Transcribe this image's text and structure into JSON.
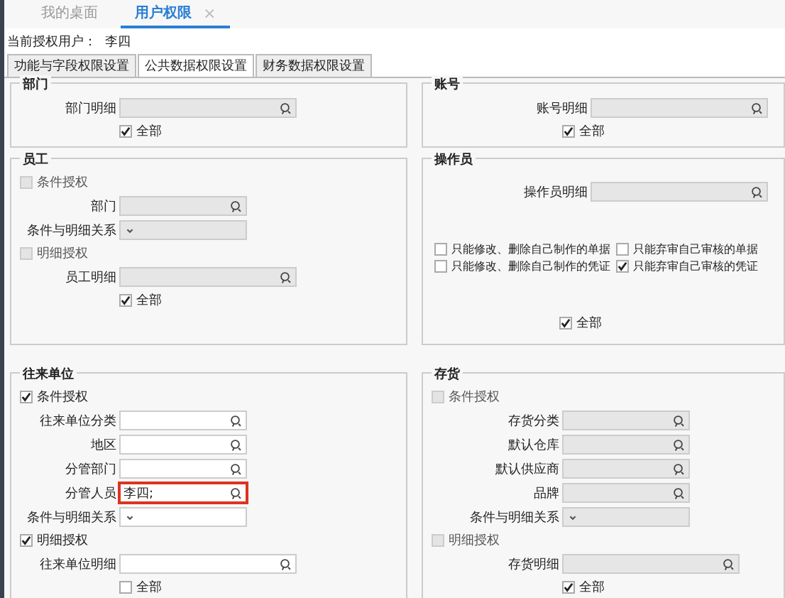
{
  "tabs": [
    {
      "label": "我的桌面",
      "selected": false
    },
    {
      "label": "用户权限",
      "selected": true,
      "close": "×"
    }
  ],
  "current_user": {
    "label": "当前授权用户：",
    "value": "李四"
  },
  "sub_tabs": [
    {
      "label": "功能与字段权限设置",
      "selected": false
    },
    {
      "label": "公共数据权限设置",
      "selected": true
    },
    {
      "label": "财务数据权限设置",
      "selected": false
    }
  ],
  "columns": [
    [
      {
        "title": "部门",
        "rows": [
          {
            "kind": "lookup",
            "label": "部门明细",
            "disabled": true,
            "wide": true
          },
          {
            "kind": "all",
            "label": "全部",
            "checked": true
          }
        ]
      },
      {
        "title": "员工",
        "rows": [
          {
            "kind": "check",
            "label": "条件授权",
            "checked": false,
            "disabled": true
          },
          {
            "kind": "lookup",
            "label": "部门",
            "disabled": true,
            "wide": false
          },
          {
            "kind": "select",
            "label": "条件与明细关系",
            "disabled": true
          },
          {
            "kind": "check",
            "label": "明细授权",
            "checked": false,
            "disabled": true
          },
          {
            "kind": "lookup",
            "label": "员工明细",
            "disabled": true,
            "wide": true
          },
          {
            "kind": "all",
            "label": "全部",
            "checked": true
          }
        ]
      },
      {
        "title": "往来单位",
        "rows": [
          {
            "kind": "check",
            "label": "条件授权",
            "checked": true,
            "disabled": false
          },
          {
            "kind": "lookup",
            "label": "往来单位分类",
            "disabled": false,
            "wide": false
          },
          {
            "kind": "lookup",
            "label": "地区",
            "disabled": false,
            "wide": false
          },
          {
            "kind": "lookup",
            "label": "分管部门",
            "disabled": false,
            "wide": false
          },
          {
            "kind": "lookup",
            "label": "分管人员",
            "disabled": false,
            "wide": false,
            "value": "李四;",
            "highlighted": true
          },
          {
            "kind": "select",
            "label": "条件与明细关系",
            "disabled": false
          },
          {
            "kind": "check",
            "label": "明细授权",
            "checked": true,
            "disabled": false
          },
          {
            "kind": "lookup",
            "label": "往来单位明细",
            "disabled": false,
            "wide": true
          },
          {
            "kind": "all",
            "label": "全部",
            "checked": false
          }
        ]
      }
    ],
    [
      {
        "title": "账号",
        "rows": [
          {
            "kind": "lookup",
            "label": "账号明细",
            "disabled": true,
            "wide": true
          },
          {
            "kind": "all",
            "label": "全部",
            "checked": true
          }
        ]
      },
      {
        "title": "操作员",
        "rows": [
          {
            "kind": "lookup",
            "label": "操作员明细",
            "disabled": true,
            "wide": true
          },
          {
            "kind": "grid",
            "items": [
              {
                "label": "只能修改、删除自己制作的单据",
                "checked": false
              },
              {
                "label": "只能弃审自己审核的单据",
                "checked": false
              },
              {
                "label": "只能修改、删除自己制作的凭证",
                "checked": false
              },
              {
                "label": "只能弃审自己审核的凭证",
                "checked": true
              }
            ]
          },
          {
            "kind": "all",
            "label": "全部",
            "checked": true
          }
        ]
      },
      {
        "title": "存货",
        "rows": [
          {
            "kind": "check",
            "label": "条件授权",
            "checked": false,
            "disabled": true
          },
          {
            "kind": "lookup",
            "label": "存货分类",
            "disabled": true,
            "wide": false
          },
          {
            "kind": "lookup",
            "label": "默认仓库",
            "disabled": true,
            "wide": false
          },
          {
            "kind": "lookup",
            "label": "默认供应商",
            "disabled": true,
            "wide": false
          },
          {
            "kind": "lookup",
            "label": "品牌",
            "disabled": true,
            "wide": false
          },
          {
            "kind": "select",
            "label": "条件与明细关系",
            "disabled": true
          },
          {
            "kind": "check",
            "label": "明细授权",
            "checked": false,
            "disabled": true
          },
          {
            "kind": "lookup",
            "label": "存货明细",
            "disabled": true,
            "wide": true
          },
          {
            "kind": "all",
            "label": "全部",
            "checked": true
          }
        ]
      }
    ]
  ]
}
